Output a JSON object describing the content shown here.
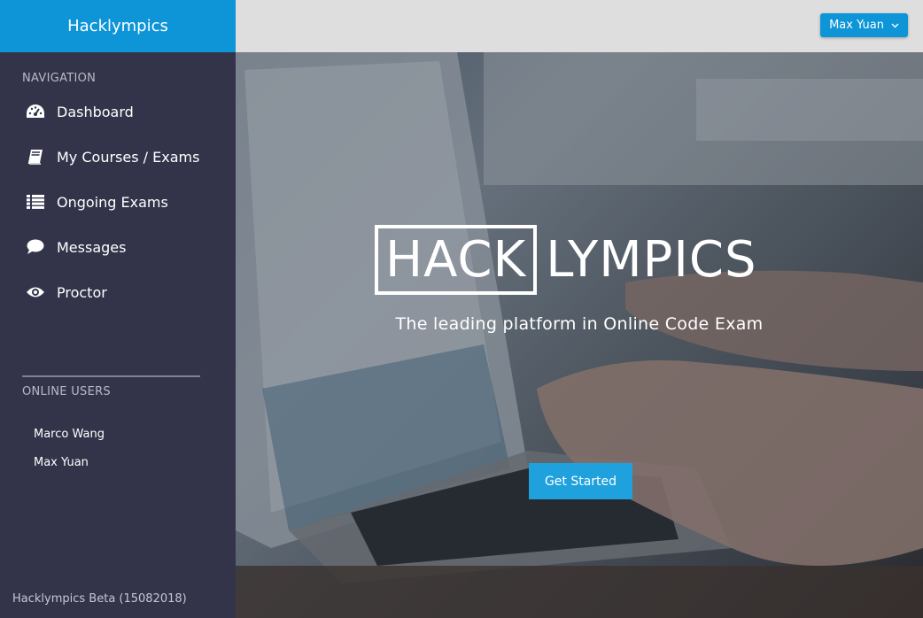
{
  "sidebar": {
    "brand": "Hacklympics",
    "nav_label": "NAVIGATION",
    "items": [
      {
        "label": "Dashboard",
        "icon": "dashboard-icon"
      },
      {
        "label": "My Courses / Exams",
        "icon": "book-icon"
      },
      {
        "label": "Ongoing Exams",
        "icon": "list-icon"
      },
      {
        "label": "Messages",
        "icon": "comment-icon"
      },
      {
        "label": "Proctor",
        "icon": "eye-icon"
      }
    ],
    "online_label": "ONLINE USERS",
    "online_users": [
      "Marco Wang",
      "Max Yuan"
    ],
    "footer": "Hacklympics Beta (15082018)"
  },
  "topbar": {
    "user": "Max Yuan",
    "user_icon": "chevron-down-icon"
  },
  "hero": {
    "logo_boxed": "HACK",
    "logo_rest": "LYMPICS",
    "tagline": "The leading platform in Online Code Exam",
    "cta_label": "Get Started"
  },
  "colors": {
    "brand_blue": "#0d95d8",
    "sidebar_bg": "#33344a",
    "topbar_bg": "#dedede",
    "cta_blue": "#1fa1dd"
  }
}
